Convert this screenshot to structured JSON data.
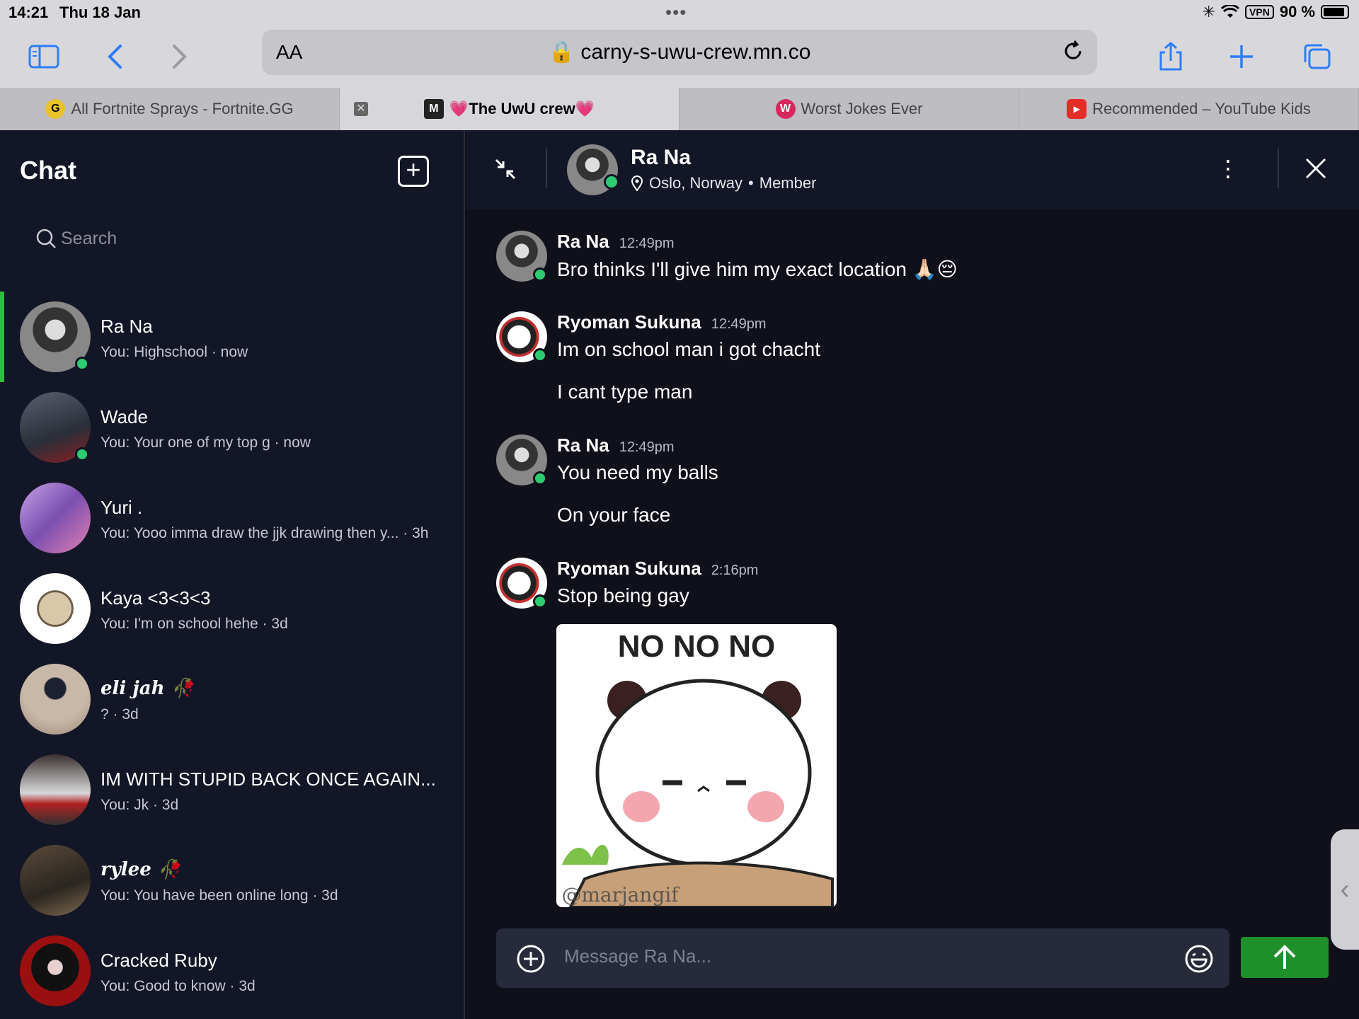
{
  "status": {
    "time": "14:21",
    "date": "Thu 18 Jan",
    "vpn": "VPN",
    "battery": "90 %"
  },
  "toolbar": {
    "aa": "AA",
    "url": "carny-s-uwu-crew.mn.co"
  },
  "tabs": [
    {
      "label": "All Fortnite Sprays - Fortnite.GG",
      "icon": "gg-icon"
    },
    {
      "label": "💗The UwU crew💗",
      "icon": "mighty-icon"
    },
    {
      "label": "Worst Jokes Ever",
      "icon": "w-icon"
    },
    {
      "label": "Recommended – YouTube Kids",
      "icon": "youtube-icon"
    }
  ],
  "sidebar": {
    "title": "Chat",
    "search_placeholder": "Search",
    "conversations": [
      {
        "name": "Ra Na",
        "preview": "You: Highschool · now",
        "online": true,
        "active": true
      },
      {
        "name": "Wade",
        "preview": "You: Your one of my top g · now",
        "online": true
      },
      {
        "name": "Yuri .",
        "preview": "You: Yooo imma draw the jjk drawing then y... · 3h",
        "online": false
      },
      {
        "name": "Kaya <3<3<3",
        "preview": "You: I'm on school hehe · 3d",
        "online": false
      },
      {
        "name": "eli jah 🥀",
        "preview": "? · 3d",
        "online": false
      },
      {
        "name": "IM WITH STUPID BACK ONCE AGAIN...",
        "preview": "You: Jk · 3d",
        "online": false
      },
      {
        "name": "rylee 🥀",
        "preview": "You: You have been online long · 3d",
        "online": false
      },
      {
        "name": "Cracked Ruby",
        "preview": "You: Good to know · 3d",
        "online": false
      }
    ]
  },
  "chat": {
    "name": "Ra Na",
    "location": "Oslo, Norway",
    "dot": "•",
    "role": "Member",
    "messages": [
      {
        "author": "Ra Na",
        "time": "12:49pm",
        "lines": [
          "Bro thinks I'll give him my exact location 🙏🏻😔"
        ]
      },
      {
        "author": "Ryoman Sukuna",
        "time": "12:49pm",
        "lines": [
          "Im on school man i got chacht",
          "I cant type man"
        ]
      },
      {
        "author": "Ra Na",
        "time": "12:49pm",
        "lines": [
          "You need my balls",
          "On your face"
        ]
      },
      {
        "author": "Ryoman Sukuna",
        "time": "2:16pm",
        "lines": [
          "Stop being gay"
        ]
      }
    ],
    "gif": {
      "top_text": "NO NO NO",
      "watermark": "@marjangif"
    },
    "composer_placeholder": "Message Ra Na..."
  },
  "colors": {
    "accent": "#2fbf3e",
    "send": "#1e8f2a",
    "online": "#2ecc71",
    "bg": "#0f101a",
    "sidebar": "#131626"
  }
}
